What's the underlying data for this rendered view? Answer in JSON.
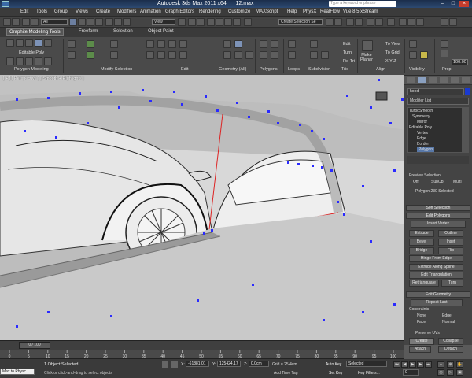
{
  "titlebar": {
    "app_title": "Autodesk 3ds Max 2011 x64",
    "file_name": "12.max",
    "search_placeholder": "Type a keyword or phrase"
  },
  "menubar": [
    "Edit",
    "Tools",
    "Group",
    "Views",
    "Create",
    "Modifiers",
    "Animation",
    "Graph Editors",
    "Rendering",
    "Customize",
    "MAXScript",
    "Help",
    "PhysX",
    "RealFlow",
    "Vue 8.5 xStream"
  ],
  "toolbar": {
    "filter_value": "All",
    "refcoord_value": "View",
    "selset_value": "Create Selection Se"
  },
  "ribbon": {
    "tabs": [
      "Graphite Modeling Tools",
      "Freeform",
      "Selection",
      "Object Paint"
    ],
    "groups": [
      "Polygon Modeling",
      "Modify Selection",
      "Edit",
      "Geometry (All)",
      "Polygons",
      "Loops",
      "Subdivision",
      "Tris",
      "Align",
      "Visibility",
      "Prop"
    ],
    "editable_poly_label": "Editable Poly",
    "edit_buttons": [
      "Edit",
      "Turn",
      "Re-Tri"
    ],
    "make_planar": "Make\nPlanar",
    "align_buttons": [
      "To View",
      "To Grid",
      "X  Y  Z"
    ],
    "prop_value": "100.00"
  },
  "viewport": {
    "label": "[ + ] [ Perspective ] [ Smooth + Highlights ]"
  },
  "command_panel": {
    "object_name": "hood",
    "modifier_list_label": "Modifier List",
    "stack": [
      "TurboSmooth",
      "Symmetry",
      "Mirror",
      "Editable Poly",
      "Vertex",
      "Edge",
      "Border",
      "Polygon"
    ],
    "preview_selection": {
      "title": "Preview Selection",
      "off": "Off",
      "subobj": "SubObj",
      "multi": "Multi"
    },
    "selection_status": "Polygon 230 Selected",
    "soft_selection": "Soft Selection",
    "edit_polygons": "Edit Polygons",
    "insert_vertex": "Insert Vertex",
    "buttons": [
      [
        "Extrude",
        "Outline"
      ],
      [
        "Bevel",
        "Inset"
      ],
      [
        "Bridge",
        "Flip"
      ]
    ],
    "hinge": "Hinge From Edge",
    "extrude_spline": "Extrude Along Spline",
    "edit_triangulation": "Edit Triangulation",
    "retriangulate": "Retriangulate",
    "turn": "Turn",
    "edit_geometry": "Edit Geometry",
    "repeat_last": "Repeat Last",
    "constraints": {
      "title": "Constraints",
      "none": "None",
      "edge": "Edge",
      "face": "Face",
      "normal": "Normal"
    },
    "preserve_uvs": "Preserve UVs",
    "create": "Create",
    "collapse": "Collapse",
    "attach": "Attach",
    "detach": "Detach"
  },
  "timeline": {
    "frame_label": "0 / 100",
    "ticks": [
      "0",
      "5",
      "10",
      "15",
      "20",
      "25",
      "30",
      "35",
      "40",
      "45",
      "50",
      "55",
      "60",
      "65",
      "70",
      "75",
      "80",
      "85",
      "90",
      "95",
      "100"
    ]
  },
  "statusbar": {
    "maxscript": "Max to Physc",
    "objects_selected": "1 Object Selected",
    "prompt": "Click or click-and-drag to select objects",
    "x_label": "X:",
    "x_value": "-61881.01",
    "y_label": "Y:",
    "y_value": "125424.17",
    "z_label": "Z:",
    "z_value": "0.0cm",
    "grid": "Grid = 25.4cm",
    "add_time_tag": "Add Time Tag",
    "auto_key": "Auto Key",
    "selected": "Selected",
    "set_key": "Set Key",
    "key_filters": "Key Filters...",
    "frame": "0"
  },
  "colors": {
    "viewport_bg": "#bdbdbd",
    "vertex": "#2a2aff",
    "ui_dark": "#444444",
    "timeline_marker": "#e08a1e"
  }
}
